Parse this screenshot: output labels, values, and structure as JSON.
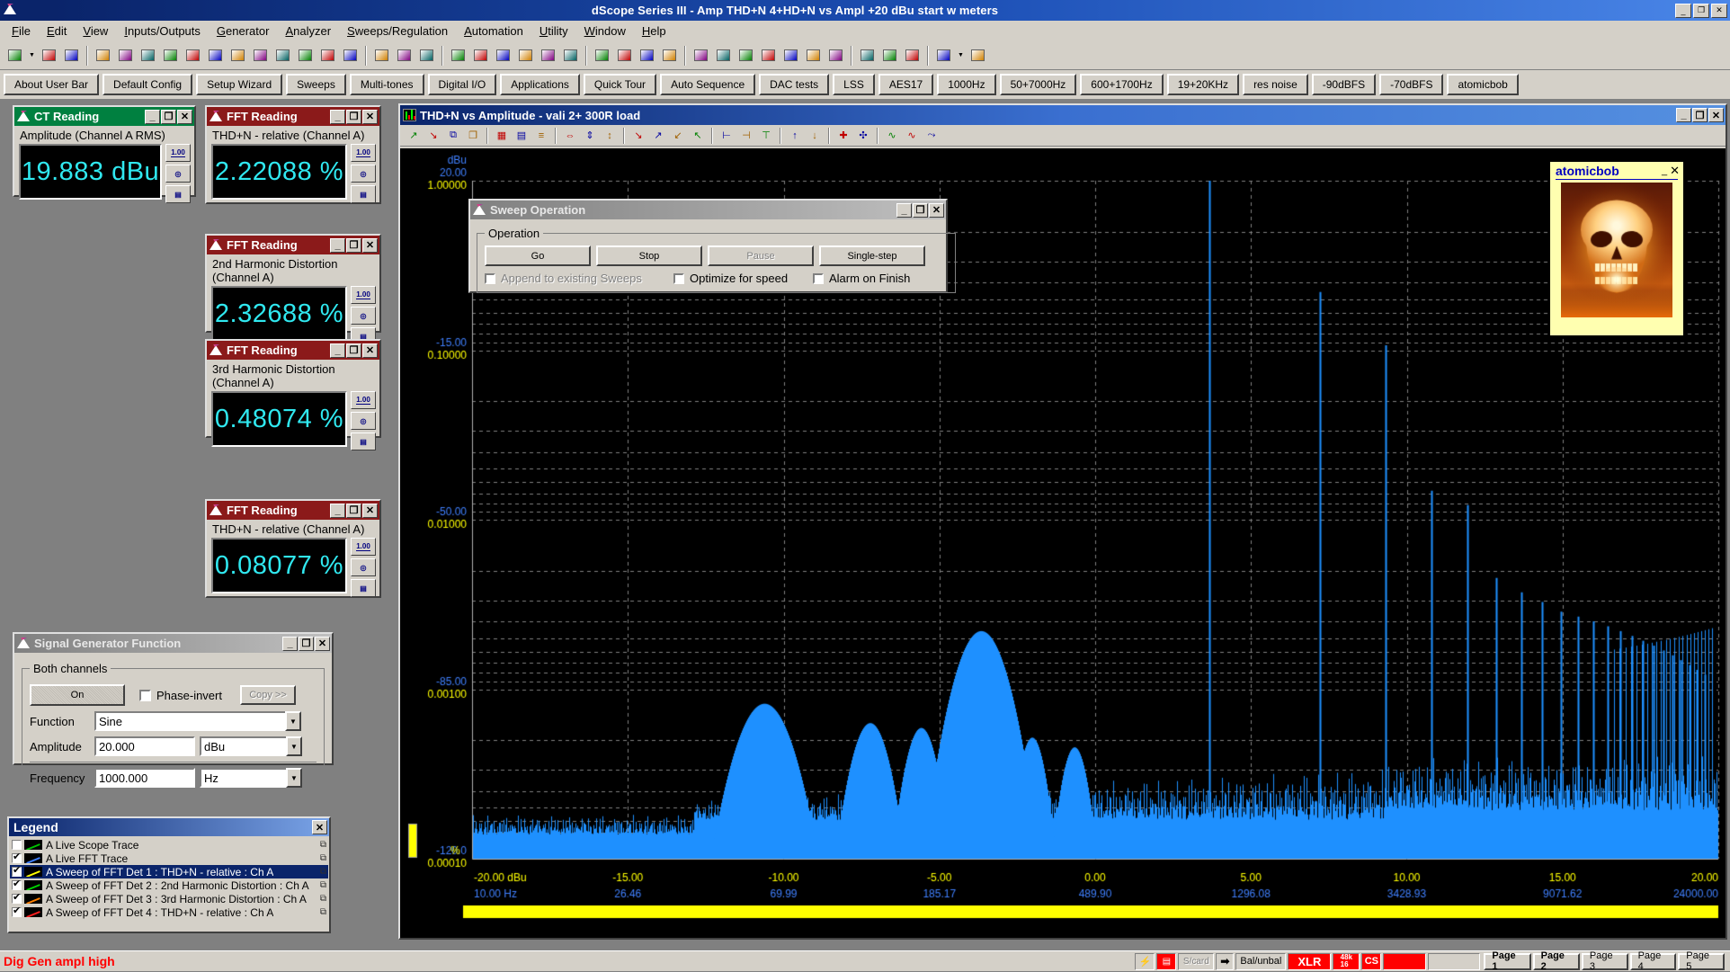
{
  "window": {
    "title": "dScope Series III - Amp THD+N 4+HD+N vs Ampl +20 dBu start w meters",
    "minimize": "_",
    "maximize": "❐",
    "close": "✕",
    "app_icon": "dscope-logo-icon"
  },
  "menu": [
    "File",
    "Edit",
    "View",
    "Inputs/Outputs",
    "Generator",
    "Analyzer",
    "Sweeps/Regulation",
    "Automation",
    "Utility",
    "Window",
    "Help"
  ],
  "userbar": [
    "About User Bar",
    "Default Config",
    "Setup Wizard",
    "Sweeps",
    "Multi-tones",
    "Digital I/O",
    "Applications",
    "Quick Tour",
    "Auto Sequence",
    "DAC tests",
    "LSS",
    "AES17",
    "1000Hz",
    "50+7000Hz",
    "600+1700Hz",
    "19+20KHz",
    "res noise",
    "-90dBFS",
    "-70dBFS",
    "atomicbob"
  ],
  "meters": [
    {
      "title": "CT Reading",
      "kind": "ct",
      "label": "Amplitude (Channel A RMS)",
      "value": "19.883 dBu"
    },
    {
      "title": "FFT Reading",
      "kind": "fft",
      "label": "THD+N - relative (Channel A)",
      "value": "2.22088 %"
    },
    {
      "title": "FFT Reading",
      "kind": "fft",
      "label": "2nd Harmonic Distortion (Channel A)",
      "value": "2.32688 %"
    },
    {
      "title": "FFT Reading",
      "kind": "fft",
      "label": "3rd Harmonic Distortion (Channel A)",
      "value": "0.48074 %"
    },
    {
      "title": "FFT Reading",
      "kind": "fft",
      "label": "THD+N - relative (Channel A)",
      "value": "0.08077 %"
    }
  ],
  "meter_side_buttons": [
    "1.00",
    "scope-probe-icon",
    "table-edit-icon"
  ],
  "siggen": {
    "title": "Signal Generator Function",
    "group": "Both channels",
    "on_label": "On",
    "phase_invert_label": "Phase-invert",
    "phase_invert_checked": false,
    "copy_label": "Copy >>",
    "rows": [
      {
        "label": "Function",
        "value": "Sine",
        "unit": null
      },
      {
        "label": "Amplitude",
        "value": "20.000",
        "unit": "dBu"
      },
      {
        "label": "Frequency",
        "value": "1000.000",
        "unit": "Hz"
      }
    ]
  },
  "legend": {
    "title": "Legend",
    "close": "✕",
    "items": [
      {
        "checked": false,
        "color": "#00c000",
        "label": "A Live Scope Trace",
        "selected": false
      },
      {
        "checked": true,
        "color": "#4080ff",
        "label": "A Live FFT Trace",
        "selected": false
      },
      {
        "checked": true,
        "color": "#ffff00",
        "label": "A Sweep of FFT Det 1 : THD+N - relative : Ch A",
        "selected": true
      },
      {
        "checked": true,
        "color": "#00d000",
        "label": "A Sweep of FFT Det 2 : 2nd Harmonic Distortion : Ch A",
        "selected": false
      },
      {
        "checked": true,
        "color": "#ff8000",
        "label": "A Sweep of FFT Det 3 : 3rd Harmonic Distortion : Ch A",
        "selected": false
      },
      {
        "checked": true,
        "color": "#ff2020",
        "label": "A Sweep of FFT Det 4 : THD+N - relative : Ch A",
        "selected": false
      }
    ]
  },
  "chart_window": {
    "title": "THD+N vs Amplitude - vali 2+  300R load",
    "minimize": "_",
    "maximize": "❐",
    "close": "✕",
    "icon": "fft-graph-icon"
  },
  "sweep_dialog": {
    "title": "Sweep Operation",
    "minimize": "_",
    "maximize": "❐",
    "close": "✕",
    "group": "Operation",
    "buttons": [
      {
        "label": "Go",
        "enabled": true
      },
      {
        "label": "Stop",
        "enabled": true
      },
      {
        "label": "Pause",
        "enabled": false
      },
      {
        "label": "Single-step",
        "enabled": true
      }
    ],
    "checkboxes": [
      {
        "label": "Append to existing Sweeps",
        "checked": false,
        "enabled": false
      },
      {
        "label": "Optimize for speed",
        "checked": false,
        "enabled": true
      },
      {
        "label": "Alarm on Finish",
        "checked": false,
        "enabled": true
      }
    ]
  },
  "image_window": {
    "title": "atomicbob",
    "minimize": "_",
    "close": "✕",
    "image": "atomic-skull-image"
  },
  "statusbar": {
    "message": "Dig Gen ampl high",
    "cells": [
      "analog-out-icon",
      "digital-out-icon",
      "S/card",
      "➡",
      "Bal/unbal",
      "XLR",
      "48k 16",
      "CS",
      "",
      ""
    ],
    "pages": [
      {
        "label": "Page 1",
        "active": true
      },
      {
        "label": "Page 2",
        "active": true
      },
      {
        "label": "Page 3",
        "active": false
      },
      {
        "label": "Page 4",
        "active": false
      },
      {
        "label": "Page 5",
        "active": false
      }
    ]
  },
  "chart_data": {
    "type": "line",
    "title": "THD+N vs Amplitude - vali 2+  300R load",
    "xlabel": "dBu / Hz",
    "ylabel": "dBu / %",
    "x_axis_primary": {
      "unit": "dBu",
      "ticks": [
        "-20.00 dBu",
        "-15.00",
        "-10.00",
        "-5.00",
        "0.00",
        "5.00",
        "10.00",
        "15.00",
        "20.00"
      ],
      "values": [
        -20,
        -15,
        -10,
        -5,
        0,
        5,
        10,
        15,
        20
      ],
      "color": "#ffff00"
    },
    "x_axis_secondary": {
      "unit": "Hz",
      "ticks": [
        "10.00 Hz",
        "26.46",
        "69.99",
        "185.17",
        "489.90",
        "1296.08",
        "3428.93",
        "9071.62",
        "24000.00"
      ],
      "values": [
        10.0,
        26.46,
        69.99,
        185.17,
        489.9,
        1296.08,
        3428.93,
        9071.62,
        24000.0
      ],
      "color": "#4080ff"
    },
    "y_axis_primary": {
      "unit": "dBu",
      "ticks": [
        "20.00",
        "-15.00",
        "-50.00",
        "-85.00",
        "-120.0"
      ],
      "values": [
        20,
        -15,
        -50,
        -85,
        -120
      ],
      "color": "#4080ff"
    },
    "y_axis_secondary": {
      "unit": "%",
      "ticks": [
        "1.00000",
        "0.10000",
        "0.01000",
        "0.00100",
        "0.00010"
      ],
      "values": [
        1.0,
        0.1,
        0.01,
        0.001,
        0.0001
      ],
      "color": "#ffff00",
      "log": true
    },
    "grid": true,
    "legend": "external",
    "series": [
      {
        "name": "A Live FFT Trace",
        "color": "#1e90ff",
        "type": "spectrum",
        "note": "FFT spectrum with fundamental at ~1 kHz and harmonic series",
        "peaks_hz": [
          1000,
          2000,
          3000,
          4000,
          5000,
          6000,
          7000,
          8000,
          9000,
          10000,
          11000,
          12000,
          13000,
          14000,
          15000,
          16000,
          17000,
          18000,
          19000,
          20000,
          21000,
          22000
        ],
        "peaks_dbu": [
          20.0,
          -3.0,
          -14.0,
          -44.0,
          -47.0,
          -62.0,
          -65.0,
          -67.0,
          -69.0,
          -70.0,
          -71.0,
          -72.0,
          -73.0,
          -74.0,
          -75.0,
          -76.0,
          -77.0,
          -78.0,
          -79.0,
          -80.0,
          -81.0,
          -82.0
        ],
        "noise_floor_dbu": -112.0
      },
      {
        "name": "A Sweep of FFT Det 1 : THD+N - relative : Ch A",
        "color": "#ffff00",
        "type": "sweep",
        "x": [
          -20,
          -15,
          -10,
          -5,
          0,
          5,
          10,
          15,
          20
        ],
        "y_percent": [
          0.0001,
          0.0001,
          0.0001,
          0.0001,
          0.0001,
          0.0001,
          0.0001,
          0.0001,
          0.0001
        ]
      },
      {
        "name": "A Sweep of FFT Det 2 : 2nd Harmonic Distortion : Ch A",
        "color": "#00d000",
        "type": "sweep",
        "x": [
          -20,
          -15,
          -10,
          -5,
          0,
          5,
          10,
          15,
          20
        ],
        "y_percent": [
          0.0001,
          0.0001,
          0.0001,
          0.0001,
          0.0001,
          0.0001,
          0.0001,
          0.0001,
          0.0001
        ]
      },
      {
        "name": "A Sweep of FFT Det 3 : 3rd Harmonic Distortion : Ch A",
        "color": "#ff8000",
        "type": "sweep",
        "x": [
          -20,
          -15,
          -10,
          -5,
          0,
          5,
          10,
          15,
          20
        ],
        "y_percent": [
          0.0001,
          0.0001,
          0.0001,
          0.0001,
          0.0001,
          0.0001,
          0.0001,
          0.0001,
          0.0001
        ]
      },
      {
        "name": "A Sweep of FFT Det 4 : THD+N - relative : Ch A",
        "color": "#ff2020",
        "type": "sweep",
        "x": [
          -20,
          -15,
          -10,
          -5,
          0,
          5,
          10,
          15,
          20
        ],
        "y_percent": [
          0.0001,
          0.0001,
          0.0001,
          0.0001,
          0.0001,
          0.0001,
          0.0001,
          0.0001,
          0.0001
        ]
      }
    ],
    "measurements": {
      "amplitude_channel_a_rms": "19.883 dBu",
      "thd_n_relative_1": "2.22088 %",
      "second_harmonic": "2.32688 %",
      "third_harmonic": "0.48074 %",
      "thd_n_relative_2": "0.08077 %"
    }
  }
}
